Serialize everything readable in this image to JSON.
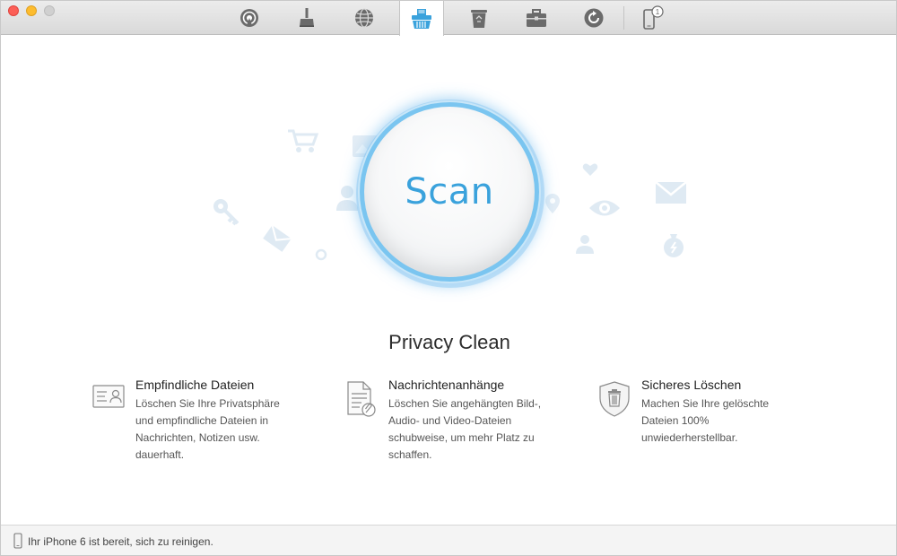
{
  "toolbar": {
    "tools": [
      {
        "icon": "airbackup-icon"
      },
      {
        "icon": "broom-icon"
      },
      {
        "icon": "globe-icon"
      },
      {
        "icon": "shredder-icon"
      },
      {
        "icon": "trash-icon"
      },
      {
        "icon": "toolbox-icon"
      },
      {
        "icon": "backup-restore-icon"
      },
      {
        "icon": "device-icon",
        "badge": "1"
      }
    ]
  },
  "scan": {
    "label": "Scan"
  },
  "section": {
    "title": "Privacy Clean"
  },
  "features": [
    {
      "icon": "id-card-icon",
      "title": "Empfindliche Dateien",
      "lines": [
        "Löschen Sie Ihre Privatsphäre",
        "und empfindliche Dateien in",
        "Nachrichten, Notizen usw.",
        "dauerhaft."
      ]
    },
    {
      "icon": "document-attachment-icon",
      "title": "Nachrichtenanhänge",
      "lines": [
        "Löschen Sie angehängten Bild-,",
        "Audio- und Video-Dateien",
        "schubweise, um mehr Platz zu",
        "schaffen."
      ]
    },
    {
      "icon": "shield-trash-icon",
      "title": "Sicheres Löschen",
      "lines": [
        "Machen Sie Ihre gelöschte",
        "Dateien 100%",
        "unwiederherstellbar."
      ]
    }
  ],
  "status": {
    "text": "Ihr iPhone 6 ist bereit, sich zu reinigen."
  },
  "colors": {
    "accent": "#3aa2dc",
    "ring": "#7ac5f0",
    "deco": "#dfeaf3"
  }
}
